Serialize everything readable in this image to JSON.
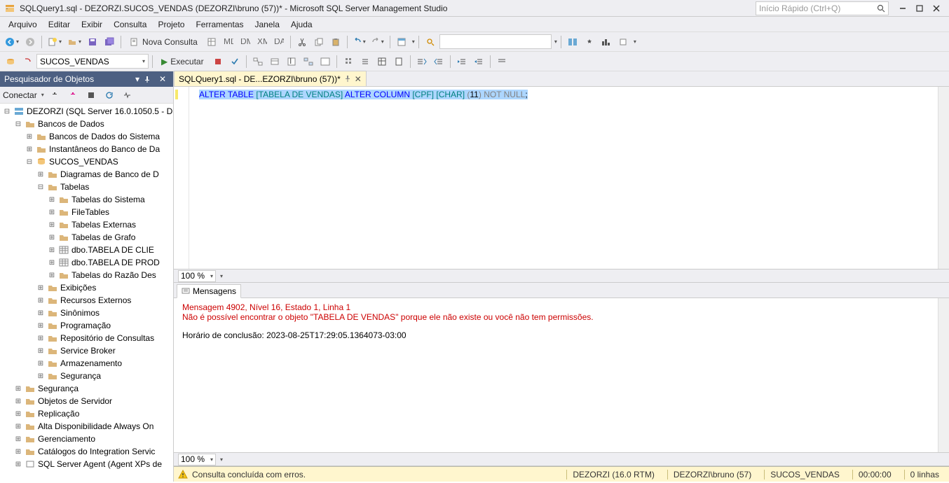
{
  "titlebar": {
    "title": "SQLQuery1.sql - DEZORZI.SUCOS_VENDAS (DEZORZI\\bruno (57))* - Microsoft SQL Server Management Studio",
    "quick_launch_placeholder": "Início Rápido (Ctrl+Q)"
  },
  "menu": [
    "Arquivo",
    "Editar",
    "Exibir",
    "Consulta",
    "Projeto",
    "Ferramentas",
    "Janela",
    "Ajuda"
  ],
  "toolbar1": {
    "new_query": "Nova Consulta",
    "db_selector": "SUCOS_VENDAS",
    "execute": "Executar"
  },
  "object_explorer": {
    "title": "Pesquisador de Objetos",
    "connect_label": "Conectar",
    "root": "DEZORZI (SQL Server 16.0.1050.5 - D",
    "tree": [
      {
        "l": "Bancos de Dados",
        "d": 1,
        "exp": true,
        "icon": "folder"
      },
      {
        "l": "Bancos de Dados do Sistema",
        "d": 2,
        "icon": "folder"
      },
      {
        "l": "Instantâneos do Banco de Da",
        "d": 2,
        "icon": "folder"
      },
      {
        "l": "SUCOS_VENDAS",
        "d": 2,
        "exp": true,
        "icon": "db"
      },
      {
        "l": "Diagramas de Banco de D",
        "d": 3,
        "icon": "folder"
      },
      {
        "l": "Tabelas",
        "d": 3,
        "exp": true,
        "icon": "folder"
      },
      {
        "l": "Tabelas do Sistema",
        "d": 4,
        "icon": "folder"
      },
      {
        "l": "FileTables",
        "d": 4,
        "icon": "folder"
      },
      {
        "l": "Tabelas Externas",
        "d": 4,
        "icon": "folder"
      },
      {
        "l": "Tabelas de Grafo",
        "d": 4,
        "icon": "folder"
      },
      {
        "l": "dbo.TABELA DE CLIE",
        "d": 4,
        "icon": "table"
      },
      {
        "l": "dbo.TABELA DE PROD",
        "d": 4,
        "icon": "table"
      },
      {
        "l": "Tabelas do Razão Des",
        "d": 4,
        "icon": "folder"
      },
      {
        "l": "Exibições",
        "d": 3,
        "icon": "folder"
      },
      {
        "l": "Recursos Externos",
        "d": 3,
        "icon": "folder"
      },
      {
        "l": "Sinônimos",
        "d": 3,
        "icon": "folder"
      },
      {
        "l": "Programação",
        "d": 3,
        "icon": "folder"
      },
      {
        "l": "Repositório de Consultas",
        "d": 3,
        "icon": "folder"
      },
      {
        "l": "Service Broker",
        "d": 3,
        "icon": "folder"
      },
      {
        "l": "Armazenamento",
        "d": 3,
        "icon": "folder"
      },
      {
        "l": "Segurança",
        "d": 3,
        "icon": "folder"
      },
      {
        "l": "Segurança",
        "d": 1,
        "icon": "folder"
      },
      {
        "l": "Objetos de Servidor",
        "d": 1,
        "icon": "folder"
      },
      {
        "l": "Replicação",
        "d": 1,
        "icon": "folder"
      },
      {
        "l": "Alta Disponibilidade Always On",
        "d": 1,
        "icon": "folder"
      },
      {
        "l": "Gerenciamento",
        "d": 1,
        "icon": "folder"
      },
      {
        "l": "Catálogos do Integration Servic",
        "d": 1,
        "icon": "folder"
      },
      {
        "l": "SQL Server Agent (Agent XPs de",
        "d": 1,
        "icon": "server"
      }
    ]
  },
  "tab": {
    "label": "SQLQuery1.sql - DE...EZORZI\\bruno (57))*"
  },
  "sql": {
    "tokens": [
      {
        "t": "ALTER TABLE",
        "c": "kw"
      },
      {
        "t": " ",
        "c": ""
      },
      {
        "t": "[TABELA DE VENDAS]",
        "c": "ident"
      },
      {
        "t": " ",
        "c": ""
      },
      {
        "t": "ALTER COLUMN",
        "c": "kw"
      },
      {
        "t": " ",
        "c": ""
      },
      {
        "t": "[CPF]",
        "c": "ident"
      },
      {
        "t": " ",
        "c": ""
      },
      {
        "t": "[CHAR]",
        "c": "ident"
      },
      {
        "t": " ",
        "c": ""
      },
      {
        "t": "(",
        "c": "gray"
      },
      {
        "t": "11",
        "c": "num"
      },
      {
        "t": ")",
        "c": "gray"
      },
      {
        "t": " ",
        "c": ""
      },
      {
        "t": "NOT NULL",
        "c": "gray"
      },
      {
        "t": ";",
        "c": ""
      }
    ]
  },
  "zoom1": "100 %",
  "zoom2": "100 %",
  "messages": {
    "tab_label": "Mensagens",
    "line1": "Mensagem 4902, Nível 16, Estado 1, Linha 1",
    "line2": "Não é possível encontrar o objeto \"TABELA DE VENDAS\" porque ele não existe ou você não tem permissões.",
    "line3": "Horário de conclusão: 2023-08-25T17:29:05.1364073-03:00"
  },
  "statusbar": {
    "text": "Consulta concluída com erros.",
    "server": "DEZORZI (16.0 RTM)",
    "user": "DEZORZI\\bruno (57)",
    "db": "SUCOS_VENDAS",
    "time": "00:00:00",
    "rows": "0 linhas"
  }
}
